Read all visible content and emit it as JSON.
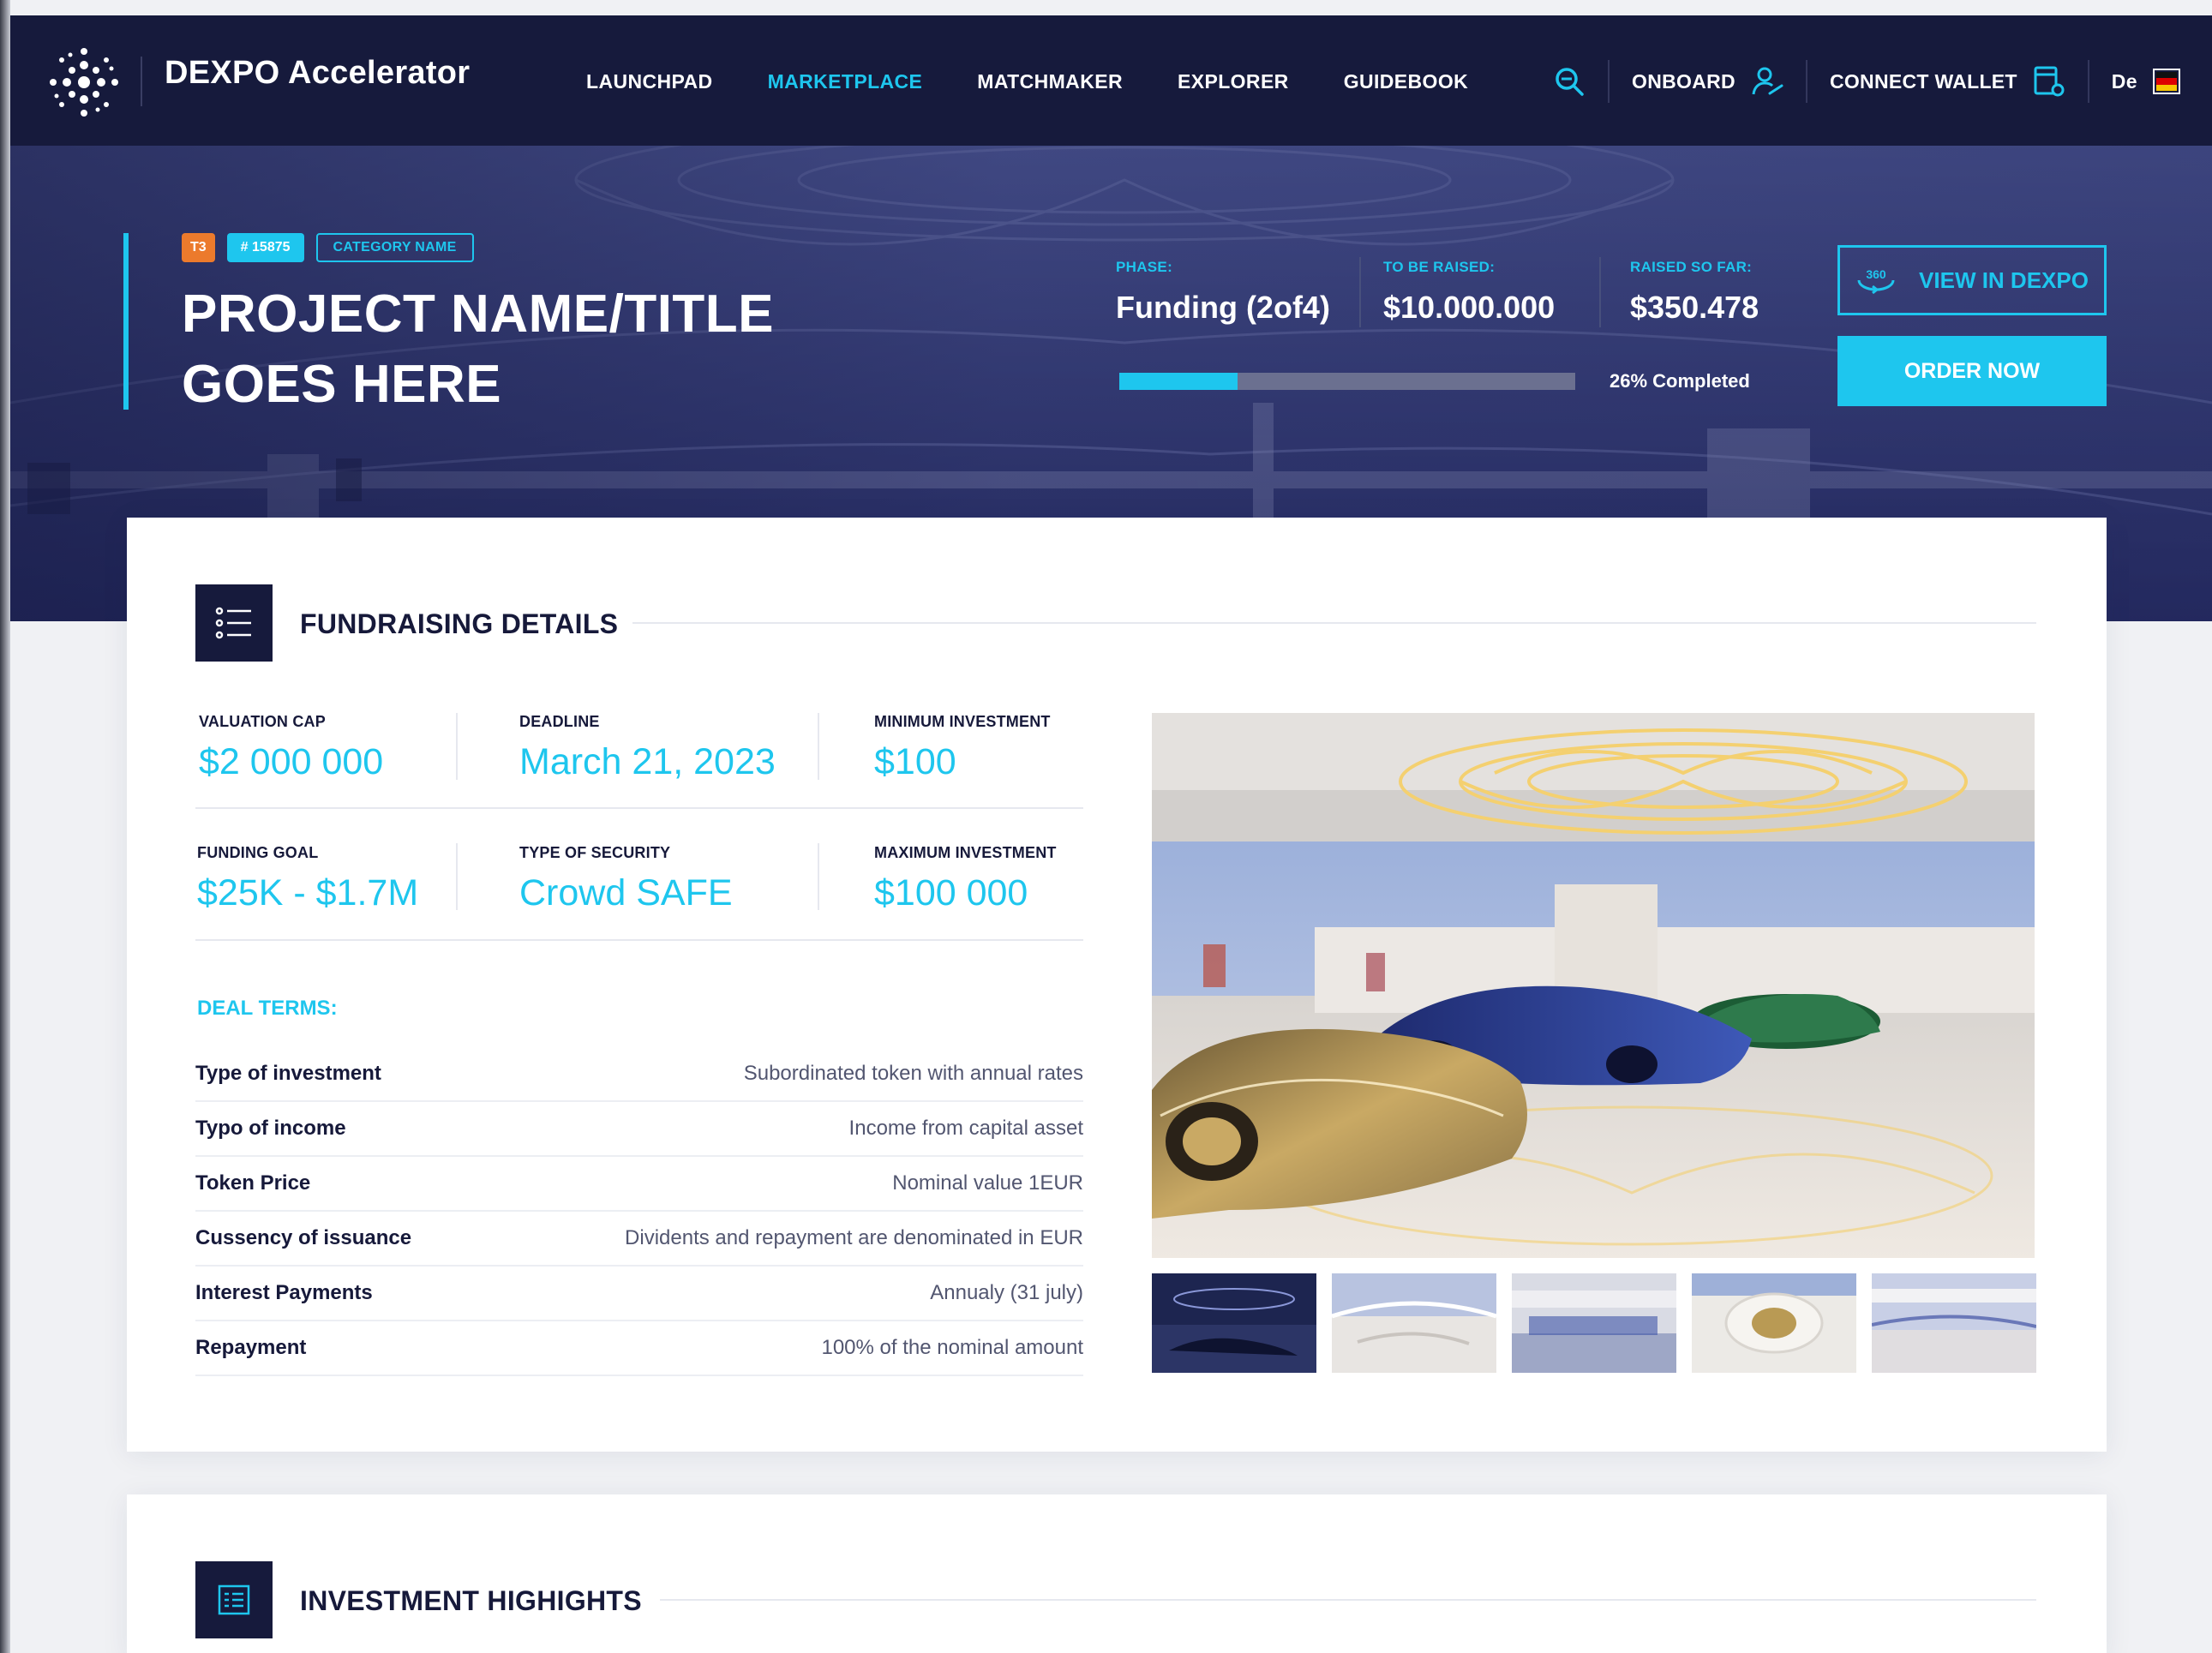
{
  "nav": {
    "brand": "DEXPO Accelerator",
    "menu": [
      {
        "label": "LAUNCHPAD",
        "active": false
      },
      {
        "label": "MARKETPLACE",
        "active": true
      },
      {
        "label": "MATCHMAKER",
        "active": false
      },
      {
        "label": "EXPLORER",
        "active": false
      },
      {
        "label": "GUIDEBOOK",
        "active": false
      }
    ],
    "onboard": "ONBOARD",
    "connect_wallet": "CONNECT WALLET",
    "language": "De"
  },
  "hero": {
    "tag_tier": "T3",
    "tag_id": "# 15875",
    "tag_category": "CATEGORY NAME",
    "title_line1": "PROJECT NAME/TITLE",
    "title_line2": "GOES HERE",
    "phase_label": "PHASE:",
    "phase_value": "Funding (2of4)",
    "to_raise_label": "TO BE RAISED:",
    "to_raise_value": "$10.000.000",
    "raised_label": "RAISED SO FAR:",
    "raised_value": "$350.478",
    "progress_percent": 26,
    "progress_label": "26%  Completed",
    "view_button": "VIEW IN DEXPO",
    "view_icon_text": "360",
    "order_button": "ORDER NOW"
  },
  "fundraising": {
    "title": "FUNDRAISING DETAILS",
    "valuation_cap_label": "VALUATION CAP",
    "valuation_cap_value": "$2 000 000",
    "deadline_label": "DEADLINE",
    "deadline_value": "March 21, 2023",
    "min_inv_label": "MINIMUM INVESTMENT",
    "min_inv_value": "$100",
    "funding_goal_label": "FUNDING GOAL",
    "funding_goal_value": "$25K - $1.7M",
    "security_label": "TYPE OF SECURITY",
    "security_value": "Crowd SAFE",
    "max_inv_label": "MAXIMUM INVESTMENT",
    "max_inv_value": "$100 000",
    "deal_terms_title": "DEAL TERMS:",
    "deal_terms": [
      {
        "key": "Type of investment",
        "value": "Subordinated token with annual rates"
      },
      {
        "key": "Typo of income",
        "value": "Income from capital asset"
      },
      {
        "key": "Token Price",
        "value": "Nominal value 1EUR"
      },
      {
        "key": "Cussency of issuance",
        "value": "Dividents and repayment are denominated in EUR"
      },
      {
        "key": "Interest Payments",
        "value": "Annualy (31 july)"
      },
      {
        "key": "Repayment",
        "value": "100% of the nominal amount"
      }
    ]
  },
  "highlights": {
    "title": "INVESTMENT HIGHIGHTS"
  },
  "colors": {
    "accent": "#1ec6ee",
    "navy": "#161a3c",
    "orange": "#ec7a2c"
  }
}
